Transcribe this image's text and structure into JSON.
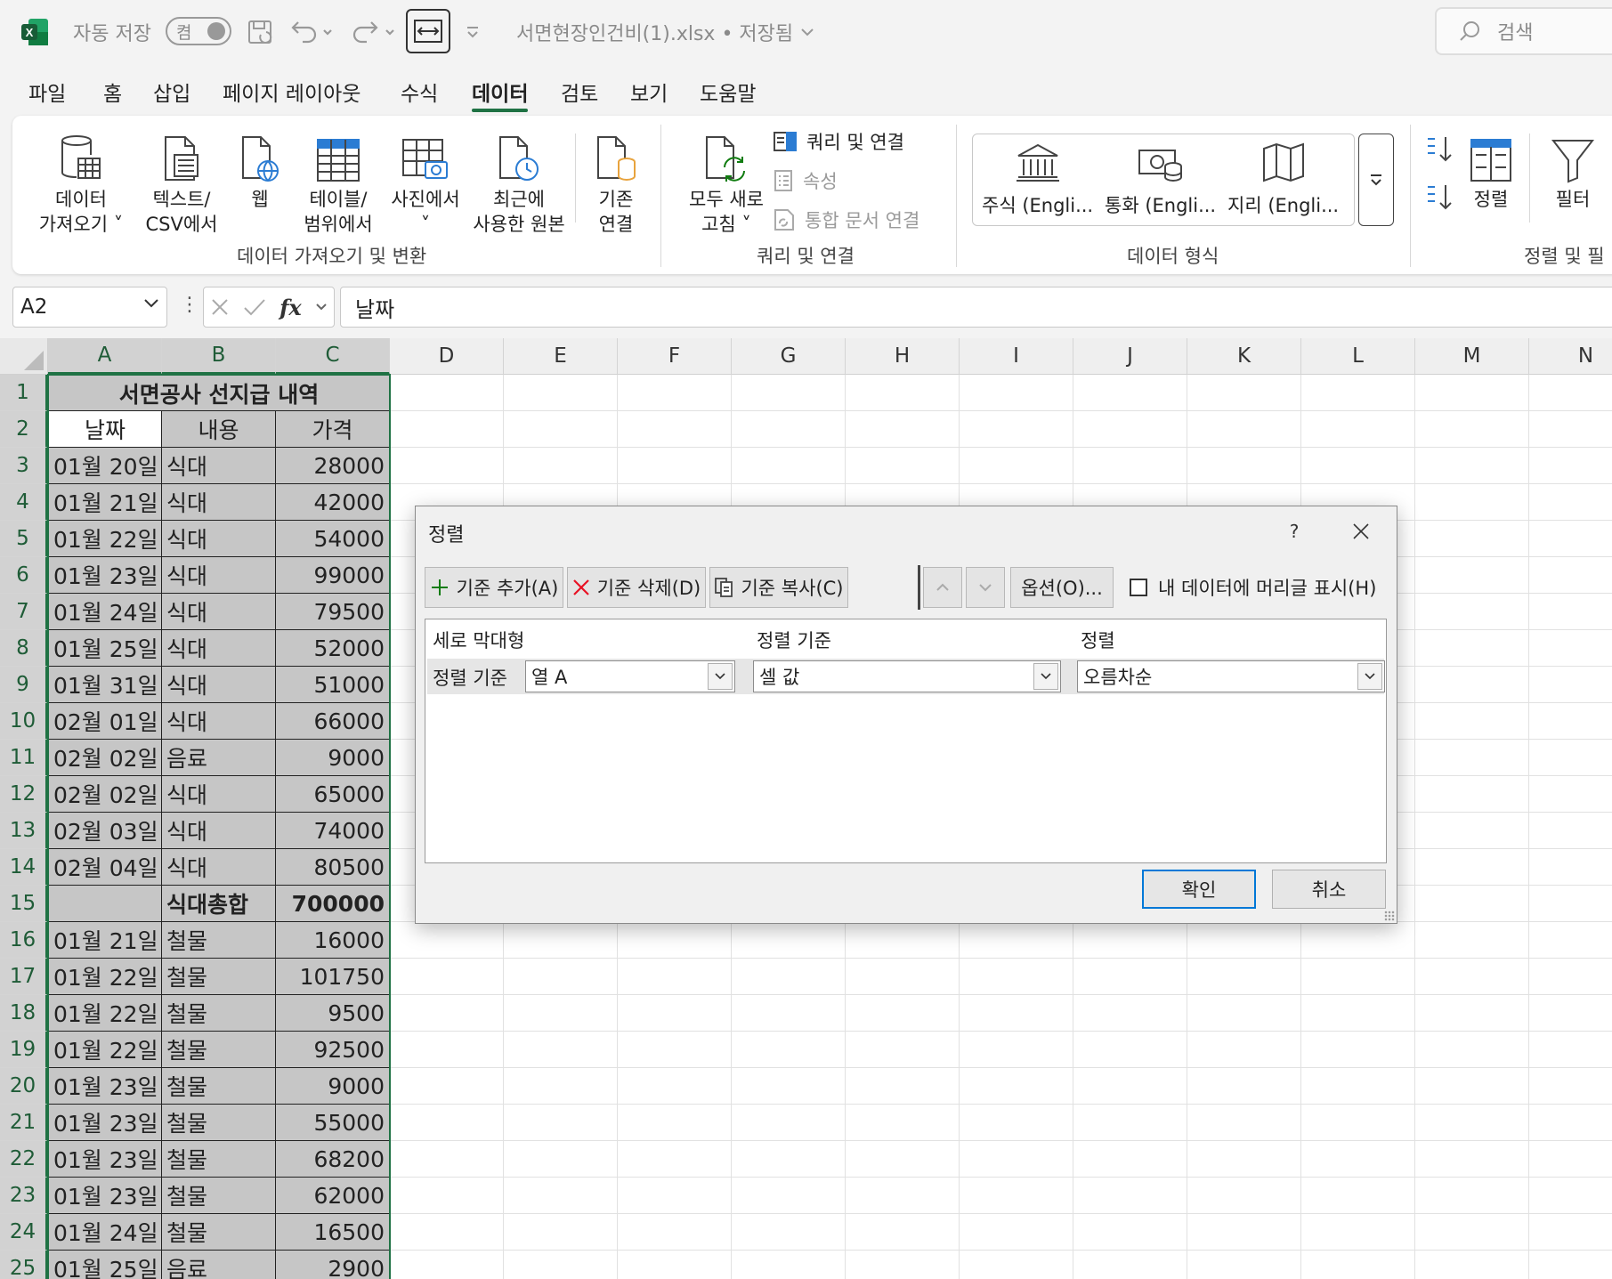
{
  "titlebar": {
    "autosave_label": "자동 저장",
    "autosave_state": "켬",
    "filename": "서면현장인건비(1).xlsx • 저장됨",
    "search_placeholder": "검색"
  },
  "tabs": [
    "파일",
    "홈",
    "삽입",
    "페이지 레이아웃",
    "수식",
    "데이터",
    "검토",
    "보기",
    "도움말"
  ],
  "active_tab": "데이터",
  "ribbon": {
    "get_data": "데이터\n가져오기 ˅",
    "text_csv": "텍스트/\nCSV에서",
    "web": "웹",
    "table_range": "테이블/\n범위에서",
    "from_picture": "사진에서\n˅",
    "recent_sources": "최근에\n사용한 원본",
    "existing_conn": "기존\n연결",
    "group1_label": "데이터 가져오기 및 변환",
    "refresh_all": "모두 새로\n고침 ˅",
    "queries_conn": "쿼리 및 연결",
    "properties": "속성",
    "edit_links": "통합 문서 연결",
    "group2_label": "쿼리 및 연결",
    "stocks": "주식 (Engli...",
    "currencies": "통화 (Engli...",
    "geography": "지리 (Engli...",
    "group3_label": "데이터 형식",
    "sort": "정렬",
    "filter": "필터",
    "group4_label": "정렬 및 필"
  },
  "formula_bar": {
    "name_box": "A2",
    "fx": "fx",
    "formula": "날짜"
  },
  "columns": [
    "A",
    "B",
    "C",
    "D",
    "E",
    "F",
    "G",
    "H",
    "I",
    "J",
    "K",
    "L",
    "M",
    "N"
  ],
  "rows": [
    "1",
    "2",
    "3",
    "4",
    "5",
    "6",
    "7",
    "8",
    "9",
    "10",
    "11",
    "12",
    "13",
    "14",
    "15",
    "16",
    "17",
    "18",
    "19",
    "20",
    "21",
    "22",
    "23",
    "24",
    "25"
  ],
  "sheet": {
    "title": "서면공사 선지급 내역",
    "headers": [
      "날짜",
      "내용",
      "가격"
    ],
    "data": [
      [
        "01월 20일",
        "식대",
        "28000"
      ],
      [
        "01월 21일",
        "식대",
        "42000"
      ],
      [
        "01월 22일",
        "식대",
        "54000"
      ],
      [
        "01월 23일",
        "식대",
        "99000"
      ],
      [
        "01월 24일",
        "식대",
        "79500"
      ],
      [
        "01월 25일",
        "식대",
        "52000"
      ],
      [
        "01월 31일",
        "식대",
        "51000"
      ],
      [
        "02월 01일",
        "식대",
        "66000"
      ],
      [
        "02월 02일",
        "음료",
        "9000"
      ],
      [
        "02월 02일",
        "식대",
        "65000"
      ],
      [
        "02월 03일",
        "식대",
        "74000"
      ],
      [
        "02월 04일",
        "식대",
        "80500"
      ],
      [
        "",
        "식대총합",
        "700000"
      ],
      [
        "01월 21일",
        "철물",
        "16000"
      ],
      [
        "01월 22일",
        "철물",
        "101750"
      ],
      [
        "01월 22일",
        "철물",
        "9500"
      ],
      [
        "01월 22일",
        "철물",
        "92500"
      ],
      [
        "01월 23일",
        "철물",
        "9000"
      ],
      [
        "01월 23일",
        "철물",
        "55000"
      ],
      [
        "01월 23일",
        "철물",
        "68200"
      ],
      [
        "01월 23일",
        "철물",
        "62000"
      ],
      [
        "01월 24일",
        "철물",
        "16500"
      ],
      [
        "01월 25일",
        "음료",
        "2900"
      ]
    ]
  },
  "dialog": {
    "title": "정렬",
    "help": "?",
    "add_level": "기준 추가(A)",
    "delete_level": "기준 삭제(D)",
    "copy_level": "기준 복사(C)",
    "options": "옵션(O)...",
    "has_headers": "내 데이터에 머리글 표시(H)",
    "has_headers_checked": false,
    "col_header_column": "세로 막대형",
    "col_header_sorton": "정렬 기준",
    "col_header_order": "정렬",
    "row_label": "정렬 기준",
    "sort_column": "열 A",
    "sort_on": "셀 값",
    "sort_order": "오름차순",
    "ok": "확인",
    "cancel": "취소"
  },
  "colors": {
    "excel_green": "#1f7244",
    "cell_fill": "#c6c6c6",
    "ok_border": "#0078d7",
    "delete_icon": "#e81123",
    "add_icon": "#107c10"
  }
}
